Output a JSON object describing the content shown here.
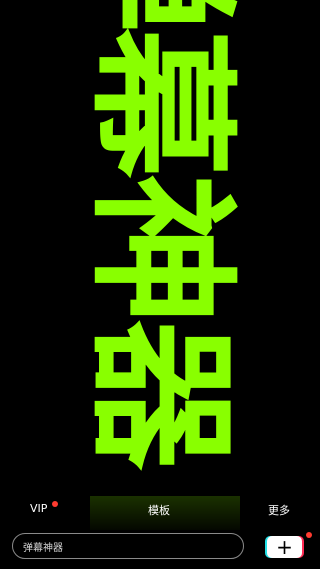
{
  "marquee": {
    "text": "弹幕神器",
    "color": "#89ff00"
  },
  "menu": {
    "vip_label": "VIP",
    "template_label": "模板",
    "more_label": "更多"
  },
  "input": {
    "value": "弹幕神器"
  },
  "add_button": {
    "icon": "plus-icon",
    "symbol": "+"
  },
  "colors": {
    "background": "#000000",
    "badge": "#ff3b30",
    "text": "#ffffff"
  }
}
